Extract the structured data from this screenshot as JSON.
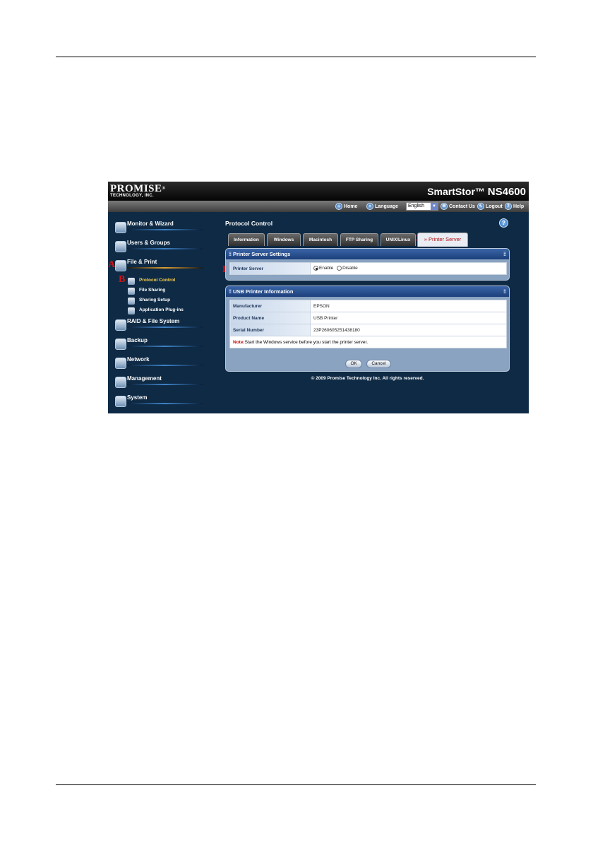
{
  "app": {
    "brand": "PROMISE",
    "brand_reg": "®",
    "brand_sub": "TECHNOLOGY, INC.",
    "product": "SmartStor™",
    "product_model": "NS4600"
  },
  "nav": {
    "home": "Home",
    "language": "Language",
    "language_value": "English",
    "contact": "Contact Us",
    "logout": "Logout",
    "help": "Help"
  },
  "sidebar": {
    "items": [
      {
        "label": "Monitor & Wizard",
        "icon": "monitor-wizard-icon"
      },
      {
        "label": "Users & Groups",
        "icon": "users-groups-icon"
      },
      {
        "label": "File & Print",
        "icon": "file-print-icon"
      },
      {
        "label": "RAID & File System",
        "icon": "raid-icon"
      },
      {
        "label": "Backup",
        "icon": "backup-icon"
      },
      {
        "label": "Network",
        "icon": "network-icon"
      },
      {
        "label": "Management",
        "icon": "management-icon"
      },
      {
        "label": "System",
        "icon": "system-icon"
      }
    ],
    "sub_items": [
      {
        "label": "Protocol Control",
        "icon": "protocol-control-icon"
      },
      {
        "label": "File Sharing",
        "icon": "file-sharing-icon"
      },
      {
        "label": "Sharing Setup",
        "icon": "sharing-setup-icon"
      },
      {
        "label": "Application Plug-ins",
        "icon": "application-plugins-icon"
      }
    ]
  },
  "markers": {
    "a": "A",
    "b": "B",
    "c": "C",
    "d": "D",
    "e": "E"
  },
  "main": {
    "title": "Protocol Control",
    "help_glyph": "?",
    "tabs": [
      "Information",
      "Windows",
      "Macintosh",
      "FTP Sharing",
      "UNIX/Linux",
      "Printer Server"
    ],
    "active_tab_prefix": "»",
    "panel1": {
      "title": "Printer Server Settings",
      "label": "Printer Server",
      "enable": "Enable",
      "disable": "Disable"
    },
    "panel2": {
      "title": "USB Printer Information",
      "rows": [
        {
          "key": "Manufacturer",
          "value": "EPSON"
        },
        {
          "key": "Product Name",
          "value": "USB Printer"
        },
        {
          "key": "Serial Number",
          "value": "23P260605251438180"
        }
      ],
      "note_label": "Note:",
      "note_text": "Start the Windows service before you start the printer server."
    },
    "ok": "OK",
    "cancel": "Cancel",
    "footer": "© 2009 Promise Technology Inc. All rights reserved."
  },
  "colors": {
    "background": "#0e2a45",
    "panel_header": "#1c3f7a",
    "active_tab_text": "#b01010",
    "marker": "#d11414",
    "active_sub_item": "#ffd24a"
  }
}
